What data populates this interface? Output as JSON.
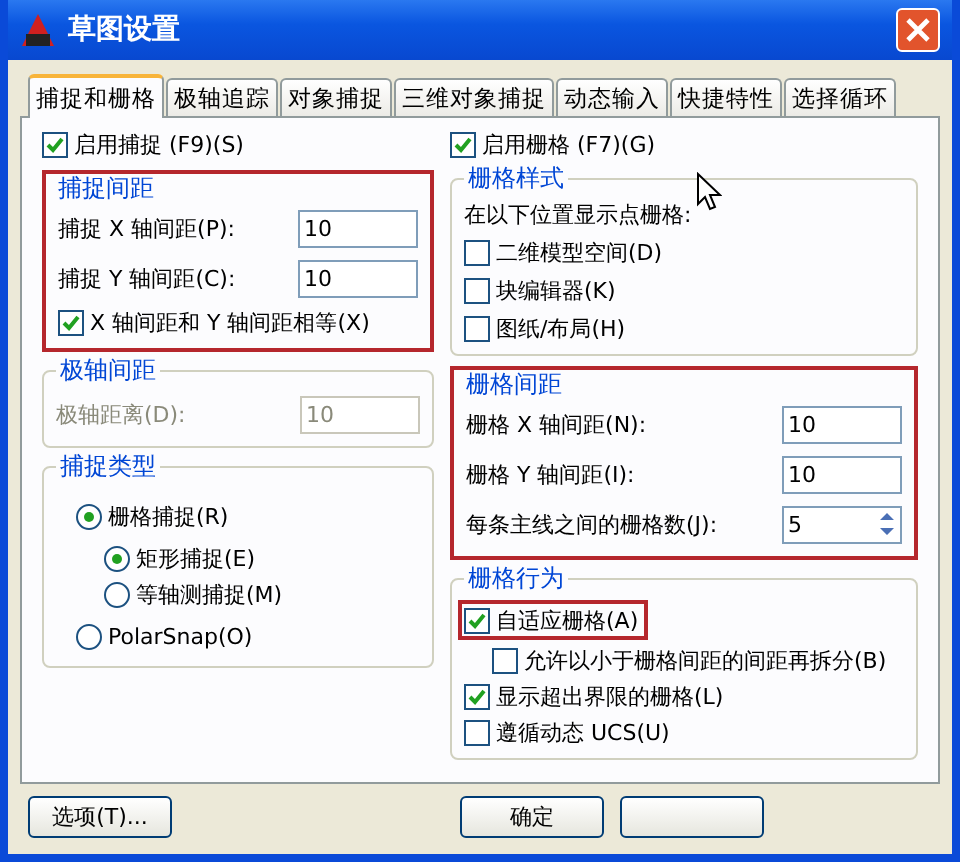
{
  "window": {
    "title": "草图设置"
  },
  "tabs": [
    {
      "label": "捕捉和栅格",
      "selected": true
    },
    {
      "label": "极轴追踪",
      "selected": false
    },
    {
      "label": "对象捕捉",
      "selected": false
    },
    {
      "label": "三维对象捕捉",
      "selected": false
    },
    {
      "label": "动态输入",
      "selected": false
    },
    {
      "label": "快捷特性",
      "selected": false
    },
    {
      "label": "选择循环",
      "selected": false
    }
  ],
  "snap_on": {
    "label": "启用捕捉 (F9)(S)",
    "checked": true
  },
  "grid_on": {
    "label": "启用栅格 (F7)(G)",
    "checked": true
  },
  "left_groups": [
    {
      "title": "捕捉间距",
      "highlighted": true,
      "items": [
        {
          "kind": "field",
          "label": "捕捉 X 轴间距(P):",
          "value": "10",
          "disabled": false
        },
        {
          "kind": "field",
          "label": "捕捉 Y 轴间距(C):",
          "value": "10",
          "disabled": false
        },
        {
          "kind": "checkbox",
          "label": "X 轴间距和 Y 轴间距相等(X)",
          "checked": true,
          "highlighted": false
        }
      ]
    },
    {
      "title": "极轴间距",
      "highlighted": false,
      "items": [
        {
          "kind": "field",
          "label": "极轴距离(D):",
          "value": "10",
          "disabled": true
        }
      ]
    },
    {
      "title": "捕捉类型",
      "highlighted": false,
      "items": [
        {
          "kind": "radio",
          "label": "栅格捕捉(R)",
          "selected": true,
          "children": [
            {
              "kind": "radio",
              "label": "矩形捕捉(E)",
              "selected": true
            },
            {
              "kind": "radio",
              "label": "等轴测捕捉(M)",
              "selected": false
            }
          ]
        },
        {
          "kind": "radio",
          "label": "PolarSnap(O)",
          "selected": false
        }
      ]
    }
  ],
  "right_groups": [
    {
      "title": "栅格样式",
      "highlighted": false,
      "items": [
        {
          "kind": "note",
          "label": "在以下位置显示点栅格:"
        },
        {
          "kind": "checkbox",
          "label": "二维模型空间(D)",
          "checked": false,
          "highlighted": false
        },
        {
          "kind": "checkbox",
          "label": "块编辑器(K)",
          "checked": false,
          "highlighted": false
        },
        {
          "kind": "checkbox",
          "label": "图纸/布局(H)",
          "checked": false,
          "highlighted": false
        }
      ]
    },
    {
      "title": "栅格间距",
      "highlighted": true,
      "items": [
        {
          "kind": "field",
          "label": "栅格 X 轴间距(N):",
          "value": "10",
          "disabled": false
        },
        {
          "kind": "field",
          "label": "栅格 Y 轴间距(I):",
          "value": "10",
          "disabled": false
        },
        {
          "kind": "spinner",
          "label": "每条主线之间的栅格数(J):",
          "value": "5",
          "disabled": false
        }
      ]
    },
    {
      "title": "栅格行为",
      "highlighted": false,
      "items": [
        {
          "kind": "checkbox",
          "label": "自适应栅格(A)",
          "checked": true,
          "highlighted": true,
          "children": [
            {
              "kind": "checkbox",
              "label": "允许以小于栅格间距的间距再拆分(B)",
              "checked": false,
              "highlighted": false
            }
          ]
        },
        {
          "kind": "checkbox",
          "label": "显示超出界限的栅格(L)",
          "checked": true,
          "highlighted": false
        },
        {
          "kind": "checkbox",
          "label": "遵循动态 UCS(U)",
          "checked": false,
          "highlighted": false
        }
      ]
    }
  ],
  "buttons": [
    {
      "label": "选项(T)..."
    },
    {
      "label": "确定"
    }
  ]
}
